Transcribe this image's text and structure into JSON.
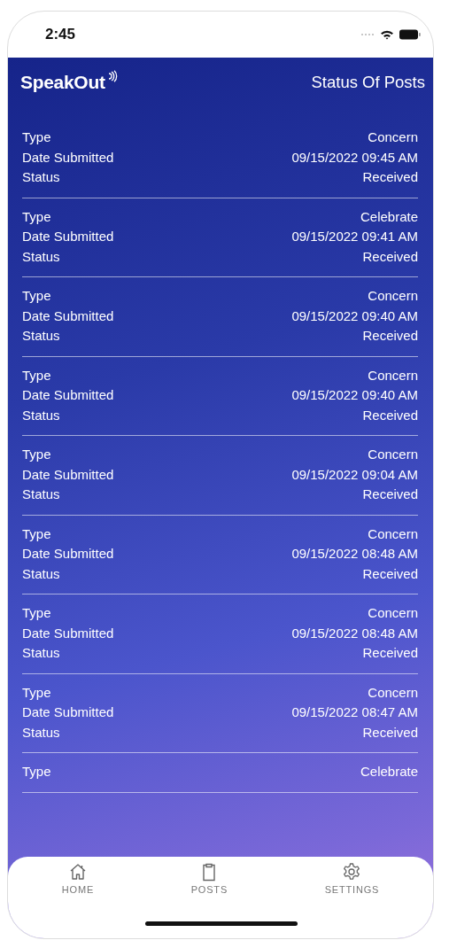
{
  "status_bar": {
    "time": "2:45"
  },
  "header": {
    "logo": "SpeakOut",
    "title": "Status Of Posts"
  },
  "posts": [
    {
      "fields": [
        {
          "label": "Type",
          "value": "Concern"
        },
        {
          "label": "Date Submitted",
          "value": "09/15/2022 09:45 AM"
        },
        {
          "label": "Status",
          "value": "Received"
        }
      ]
    },
    {
      "fields": [
        {
          "label": "Type",
          "value": "Celebrate"
        },
        {
          "label": "Date Submitted",
          "value": "09/15/2022 09:41 AM"
        },
        {
          "label": "Status",
          "value": "Received"
        }
      ]
    },
    {
      "fields": [
        {
          "label": "Type",
          "value": "Concern"
        },
        {
          "label": "Date Submitted",
          "value": "09/15/2022 09:40 AM"
        },
        {
          "label": "Status",
          "value": "Received"
        }
      ]
    },
    {
      "fields": [
        {
          "label": "Type",
          "value": "Concern"
        },
        {
          "label": "Date Submitted",
          "value": "09/15/2022 09:40 AM"
        },
        {
          "label": "Status",
          "value": "Received"
        }
      ]
    },
    {
      "fields": [
        {
          "label": "Type",
          "value": "Concern"
        },
        {
          "label": "Date Submitted",
          "value": "09/15/2022 09:04 AM"
        },
        {
          "label": "Status",
          "value": "Received"
        }
      ]
    },
    {
      "fields": [
        {
          "label": "Type",
          "value": "Concern"
        },
        {
          "label": "Date Submitted",
          "value": "09/15/2022 08:48 AM"
        },
        {
          "label": "Status",
          "value": "Received"
        }
      ]
    },
    {
      "fields": [
        {
          "label": "Type",
          "value": "Concern"
        },
        {
          "label": "Date Submitted",
          "value": "09/15/2022 08:48 AM"
        },
        {
          "label": "Status",
          "value": "Received"
        }
      ]
    },
    {
      "fields": [
        {
          "label": "Type",
          "value": "Concern"
        },
        {
          "label": "Date Submitted",
          "value": "09/15/2022 08:47 AM"
        },
        {
          "label": "Status",
          "value": "Received"
        }
      ]
    },
    {
      "fields": [
        {
          "label": "Type",
          "value": "Celebrate"
        }
      ]
    }
  ],
  "tab_bar": [
    {
      "kind": "home",
      "label": "HOME"
    },
    {
      "kind": "posts",
      "label": "POSTS"
    },
    {
      "kind": "settings",
      "label": "SETTINGS"
    }
  ]
}
